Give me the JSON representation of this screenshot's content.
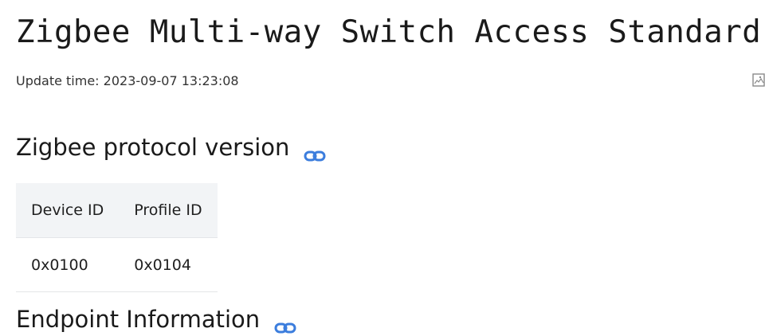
{
  "title": "Zigbee Multi-way Switch Access Standard",
  "update_time": "Update time: 2023-09-07 13:23:08",
  "icons": {
    "pdf": "pdf-download-icon",
    "link": "link-icon",
    "link_color": "#3b7ddd"
  },
  "sections": {
    "protocol": {
      "heading": "Zigbee protocol version",
      "table": {
        "headers": [
          "Device ID",
          "Profile ID"
        ],
        "rows": [
          [
            "0x0100",
            "0x0104"
          ]
        ]
      }
    },
    "endpoint": {
      "heading": "Endpoint Information"
    }
  }
}
